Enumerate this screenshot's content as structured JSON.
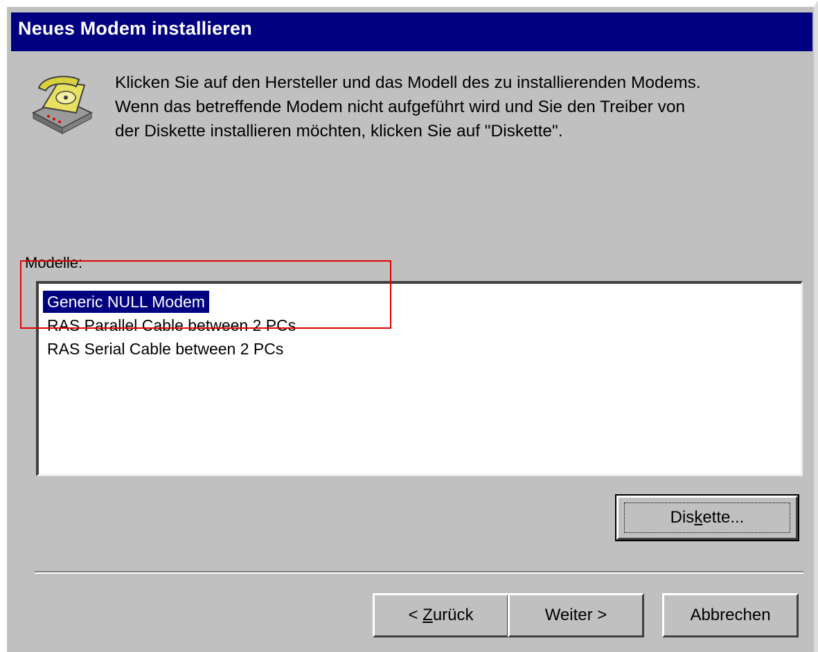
{
  "dialog": {
    "title": "Neues Modem installieren",
    "description_lines": [
      "Klicken Sie auf den Hersteller und das Modell des zu installierenden Modems.",
      "Wenn das betreffende Modem nicht aufgeführt wird und Sie den Treiber von",
      "der Diskette installieren möchten, klicken Sie auf \"Diskette\"."
    ],
    "icon": "telephone-modem-icon"
  },
  "models": {
    "label": "Modelle:",
    "items": [
      {
        "label": "Generic NULL Modem",
        "selected": true
      },
      {
        "label": "RAS Parallel Cable between 2 PCs",
        "selected": false
      },
      {
        "label": "RAS Serial Cable between 2 PCs",
        "selected": false
      }
    ]
  },
  "buttons": {
    "diskette": {
      "pre": "Dis",
      "mnemonic": "k",
      "post": "ette..."
    },
    "back": {
      "pre": "< ",
      "mnemonic": "Z",
      "post": "urück"
    },
    "next": "Weiter >",
    "cancel": "Abbrechen"
  },
  "colors": {
    "titlebar": "#000080",
    "selection": "#000080",
    "face": "#c0c0c0",
    "annotation_box": "#e00000"
  }
}
